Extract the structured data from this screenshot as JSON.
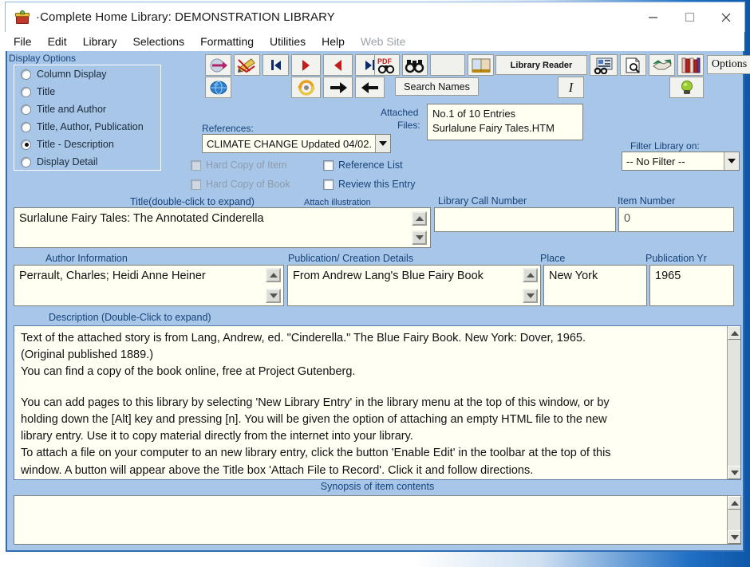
{
  "window": {
    "title": "·Complete Home Library: DEMONSTRATION LIBRARY",
    "icon": "gift-box-icon",
    "minimize": "–",
    "maximize": "▢",
    "close": "✕"
  },
  "menu": {
    "items": [
      {
        "label": "File",
        "disabled": false
      },
      {
        "label": "Edit",
        "disabled": false
      },
      {
        "label": "Library",
        "disabled": false
      },
      {
        "label": "Selections",
        "disabled": false
      },
      {
        "label": "Formatting",
        "disabled": false
      },
      {
        "label": "Utilities",
        "disabled": false
      },
      {
        "label": "Help",
        "disabled": false
      },
      {
        "label": "Web Site",
        "disabled": true
      }
    ]
  },
  "display_options": {
    "title": "Display Options",
    "selected": "Title - Description",
    "items": [
      {
        "label": "Column Display",
        "selected": false
      },
      {
        "label": "Title",
        "selected": false
      },
      {
        "label": "Title and  Author",
        "selected": false
      },
      {
        "label": "Title, Author, Publication",
        "selected": false
      },
      {
        "label": "Title - Description",
        "selected": true
      },
      {
        "label": "Display Detail",
        "selected": false
      }
    ]
  },
  "toolbar": {
    "buttons": [
      {
        "name": "exit-arrow-icon",
        "label": ""
      },
      {
        "name": "edit-pencil-icon",
        "label": ""
      },
      {
        "name": "first-record-icon",
        "label": ""
      },
      {
        "name": "next-record-icon",
        "label": ""
      },
      {
        "name": "previous-record-icon",
        "label": ""
      },
      {
        "name": "last-record-icon",
        "label": ""
      },
      {
        "name": "pdf-search-icon",
        "label": ""
      },
      {
        "name": "binoculars-search-icon",
        "label": ""
      },
      {
        "name": "books-icon",
        "label": ""
      },
      {
        "name": "library-reader-button",
        "label": "Library Reader"
      },
      {
        "name": "search-index-icon",
        "label": ""
      },
      {
        "name": "print-preview-icon",
        "label": ""
      },
      {
        "name": "handshake-icon",
        "label": ""
      },
      {
        "name": "bookshelf-icon",
        "label": ""
      },
      {
        "name": "options-button",
        "label": "Options"
      },
      {
        "name": "globe-icon",
        "label": ""
      },
      {
        "name": "refresh-icon",
        "label": ""
      },
      {
        "name": "forward-arrow-icon",
        "label": ""
      },
      {
        "name": "back-arrow-icon",
        "label": ""
      },
      {
        "name": "search-names-button",
        "label": "Search Names"
      },
      {
        "name": "italic-button",
        "label": "I"
      },
      {
        "name": "bulb-icon",
        "label": ""
      }
    ],
    "library_reader_label": "Library Reader",
    "options_label": "Options",
    "search_names_label": "Search Names",
    "italic_label": "I"
  },
  "references": {
    "label": "References:",
    "value": "CLIMATE CHANGE Updated 04/02."
  },
  "attached_files": {
    "label_line1": "Attached",
    "label_line2": "Files:",
    "entry_count": "No.1  of 10 Entries",
    "file_name": "Surlalune Fairy Tales.HTM"
  },
  "checkboxes": [
    {
      "label": "Hard Copy of Item",
      "checked": false,
      "disabled": true
    },
    {
      "label": "Hard Copy of Book",
      "checked": false,
      "disabled": true
    },
    {
      "label": "Reference List",
      "checked": false,
      "disabled": false
    },
    {
      "label": "Review this Entry",
      "checked": false,
      "disabled": false
    }
  ],
  "filter": {
    "label": "Filter Library on:",
    "value": "-- No Filter --"
  },
  "fields": {
    "title": {
      "label": "Title(double-click to expand)",
      "attach_label": "Attach illustration",
      "value": "Surlalune Fairy Tales: The Annotated Cinderella"
    },
    "call_number": {
      "label": "Library Call Number",
      "value": ""
    },
    "item_number": {
      "label": "Item Number",
      "value": "0"
    },
    "author": {
      "label": "Author Information",
      "value": "Perrault, Charles; Heidi Anne Heiner"
    },
    "publication": {
      "label": "Publication/ Creation Details",
      "value": "From Andrew Lang's Blue Fairy Book"
    },
    "place": {
      "label": "Place",
      "value": "New York"
    },
    "publication_year": {
      "label": "Publication Yr",
      "value": "1965"
    },
    "description": {
      "label": "Description (Double-Click to expand)",
      "paragraphs": [
        "Text of the attached story is from Lang, Andrew, ed. \"Cinderella.\" The Blue Fairy Book. New York: Dover, 1965.",
        "(Original published 1889.)",
        "You can find a copy of the book online, free at Project Gutenberg.",
        "You can add pages to this library by selecting 'New Library Entry' in the library menu at the top of this window, or by",
        "holding down the [Alt] key and pressing [n]. You will be given the option of attaching an empty HTML file to the new",
        "library entry. Use it to copy material directly from the internet into your library.",
        "To attach a file on your computer to an new library entry, click the button 'Enable Edit' in the toolbar at the top of this",
        "window. A button will appear above the Title box 'Attach File to Record'. Click it and follow directions."
      ]
    },
    "synopsis": {
      "label": "Synopsis of item contents",
      "value": ""
    }
  }
}
